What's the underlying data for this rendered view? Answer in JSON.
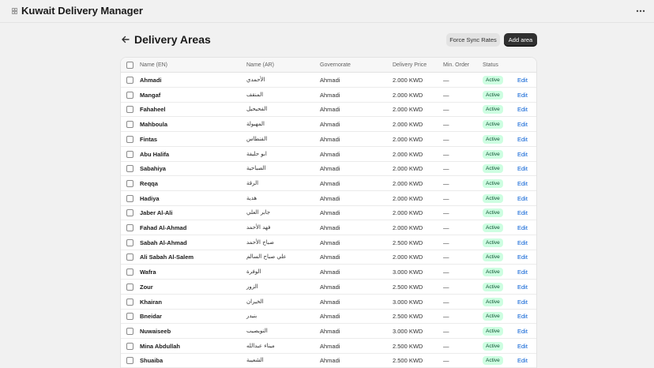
{
  "app": {
    "title": "Kuwait Delivery Manager"
  },
  "page": {
    "title": "Delivery Areas"
  },
  "actions": {
    "force_sync": "Force Sync Rates",
    "add_area": "Add area"
  },
  "table": {
    "headers": {
      "name_en": "Name (EN)",
      "name_ar": "Name (AR)",
      "governorate": "Governorate",
      "delivery_price": "Delivery Price",
      "min_order": "Min. Order",
      "status": "Status"
    },
    "edit_label": "Edit",
    "rows": [
      {
        "name_en": "Ahmadi",
        "name_ar": "الأحمدي",
        "governorate": "Ahmadi",
        "price": "2.000 KWD",
        "min_order": "—",
        "status": "Active"
      },
      {
        "name_en": "Mangaf",
        "name_ar": "المنقف",
        "governorate": "Ahmadi",
        "price": "2.000 KWD",
        "min_order": "—",
        "status": "Active"
      },
      {
        "name_en": "Fahaheel",
        "name_ar": "الفحيحيل",
        "governorate": "Ahmadi",
        "price": "2.000 KWD",
        "min_order": "—",
        "status": "Active"
      },
      {
        "name_en": "Mahboula",
        "name_ar": "المهبولة",
        "governorate": "Ahmadi",
        "price": "2.000 KWD",
        "min_order": "—",
        "status": "Active"
      },
      {
        "name_en": "Fintas",
        "name_ar": "الفنطاس",
        "governorate": "Ahmadi",
        "price": "2.000 KWD",
        "min_order": "—",
        "status": "Active"
      },
      {
        "name_en": "Abu Halifa",
        "name_ar": "ابو حليفة",
        "governorate": "Ahmadi",
        "price": "2.000 KWD",
        "min_order": "—",
        "status": "Active"
      },
      {
        "name_en": "Sabahiya",
        "name_ar": "الصباحية",
        "governorate": "Ahmadi",
        "price": "2.000 KWD",
        "min_order": "—",
        "status": "Active"
      },
      {
        "name_en": "Reqqa",
        "name_ar": "الرقة",
        "governorate": "Ahmadi",
        "price": "2.000 KWD",
        "min_order": "—",
        "status": "Active"
      },
      {
        "name_en": "Hadiya",
        "name_ar": "هدية",
        "governorate": "Ahmadi",
        "price": "2.000 KWD",
        "min_order": "—",
        "status": "Active"
      },
      {
        "name_en": "Jaber Al-Ali",
        "name_ar": "جابر العلي",
        "governorate": "Ahmadi",
        "price": "2.000 KWD",
        "min_order": "—",
        "status": "Active"
      },
      {
        "name_en": "Fahad Al-Ahmad",
        "name_ar": "فهد الأحمد",
        "governorate": "Ahmadi",
        "price": "2.000 KWD",
        "min_order": "—",
        "status": "Active"
      },
      {
        "name_en": "Sabah Al-Ahmad",
        "name_ar": "صباح الأحمد",
        "governorate": "Ahmadi",
        "price": "2.500 KWD",
        "min_order": "—",
        "status": "Active"
      },
      {
        "name_en": "Ali Sabah Al-Salem",
        "name_ar": "علي صباح السالم",
        "governorate": "Ahmadi",
        "price": "2.000 KWD",
        "min_order": "—",
        "status": "Active"
      },
      {
        "name_en": "Wafra",
        "name_ar": "الوفرة",
        "governorate": "Ahmadi",
        "price": "3.000 KWD",
        "min_order": "—",
        "status": "Active"
      },
      {
        "name_en": "Zour",
        "name_ar": "الزور",
        "governorate": "Ahmadi",
        "price": "2.500 KWD",
        "min_order": "—",
        "status": "Active"
      },
      {
        "name_en": "Khairan",
        "name_ar": "الخيران",
        "governorate": "Ahmadi",
        "price": "3.000 KWD",
        "min_order": "—",
        "status": "Active"
      },
      {
        "name_en": "Bneidar",
        "name_ar": "بنيدر",
        "governorate": "Ahmadi",
        "price": "2.500 KWD",
        "min_order": "—",
        "status": "Active"
      },
      {
        "name_en": "Nuwaiseeb",
        "name_ar": "النويصيب",
        "governorate": "Ahmadi",
        "price": "3.000 KWD",
        "min_order": "—",
        "status": "Active"
      },
      {
        "name_en": "Mina Abdullah",
        "name_ar": "ميناء عبدالله",
        "governorate": "Ahmadi",
        "price": "2.500 KWD",
        "min_order": "—",
        "status": "Active"
      },
      {
        "name_en": "Shuaiba",
        "name_ar": "الشعيبة",
        "governorate": "Ahmadi",
        "price": "2.500 KWD",
        "min_order": "—",
        "status": "Active"
      }
    ]
  },
  "colors": {
    "accent": "#303030",
    "link": "#005bd3",
    "badge_bg": "#cdfee1",
    "badge_text": "#0c5132",
    "background": "#f1f1f1"
  },
  "icons": {
    "app": "app-grid-icon",
    "menu": "more-horizontal-icon",
    "back": "arrow-left-icon"
  }
}
